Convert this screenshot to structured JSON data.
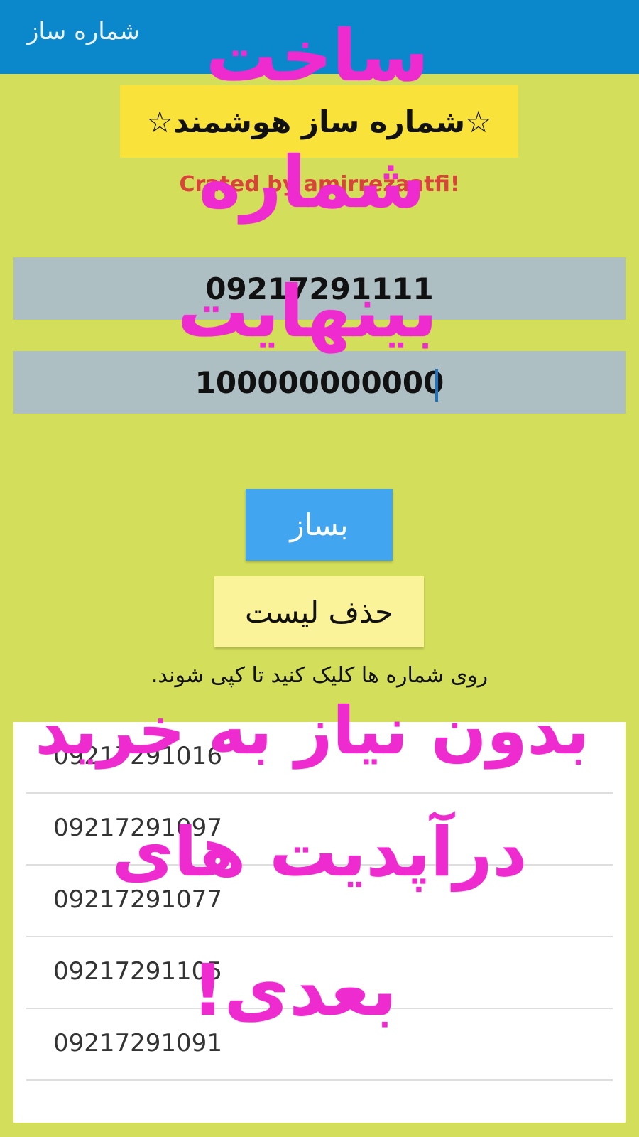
{
  "appbar": {
    "title": "شماره ساز"
  },
  "header": {
    "headline": "☆شماره ساز هوشمند☆",
    "credit": "Crated by amirrezaatfi!"
  },
  "inputs": {
    "base_number": "09217291111",
    "count": "100000000000"
  },
  "buttons": {
    "build_label": "بساز",
    "clear_label": "حذف لیست"
  },
  "hint": "روی شماره ها کلیک کنید تا کپی شوند.",
  "list": {
    "items": [
      {
        "number": "09217291016"
      },
      {
        "number": "09217291097"
      },
      {
        "number": "09217291077"
      },
      {
        "number": "09217291105"
      },
      {
        "number": "09217291091"
      }
    ]
  },
  "overlay": {
    "line1": "ساخت",
    "line2": "شماره",
    "line3": "بینهایت",
    "line4": "بدون نیاز به خرید",
    "line5": "درآپدیت های",
    "line6": "بعدی!"
  },
  "colors": {
    "background": "#d3df5a",
    "appbar": "#0a88cb",
    "headline_bg": "#f9e33b",
    "build_button": "#41a5ef",
    "clear_button": "#fbf39a",
    "overlay_text": "#ee2bcf",
    "credit_text": "#d9443a"
  }
}
